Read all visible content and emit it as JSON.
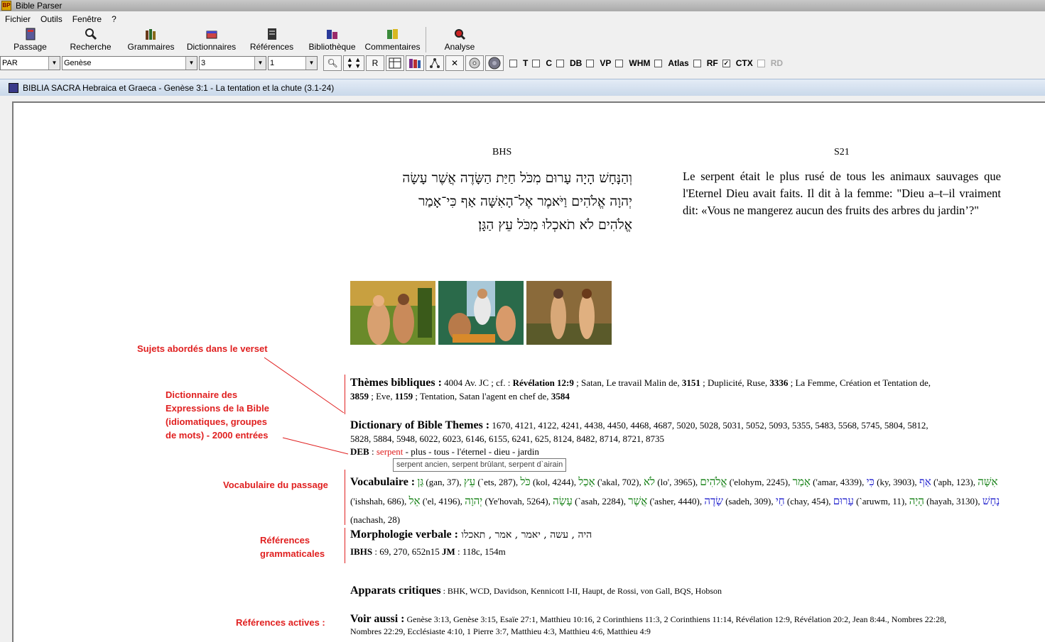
{
  "app": {
    "title": "Bible Parser",
    "icon_text": "BP"
  },
  "menu": [
    "Fichier",
    "Outils",
    "Fenêtre",
    "?"
  ],
  "toolbar": [
    {
      "label": "Passage",
      "icon": "book-icon"
    },
    {
      "label": "Recherche",
      "icon": "search-icon"
    },
    {
      "label": "Grammaires",
      "icon": "books-icon"
    },
    {
      "label": "Dictionnaires",
      "icon": "dictionary-icon"
    },
    {
      "label": "Références",
      "icon": "references-icon"
    },
    {
      "label": "Bibliothèque",
      "icon": "library-icon"
    },
    {
      "label": "Commentaires",
      "icon": "commentary-icon"
    },
    {
      "label": "Analyse",
      "icon": "analyse-icon"
    }
  ],
  "filters": {
    "version": "PAR",
    "book": "Genèse",
    "chapter": "3",
    "verse": "1",
    "r_button": "R"
  },
  "checkboxes": [
    {
      "label": "T",
      "checked": false,
      "enabled": true
    },
    {
      "label": "C",
      "checked": false,
      "enabled": true
    },
    {
      "label": "DB",
      "checked": false,
      "enabled": true
    },
    {
      "label": "VP",
      "checked": false,
      "enabled": true
    },
    {
      "label": "WHM",
      "checked": false,
      "enabled": true
    },
    {
      "label": "Atlas",
      "checked": false,
      "enabled": true
    },
    {
      "label": "RF",
      "checked": false,
      "enabled": true
    },
    {
      "label": "CTX",
      "checked": true,
      "enabled": true
    },
    {
      "label": "RD",
      "checked": false,
      "enabled": false
    }
  ],
  "document": {
    "title": "BIBLIA SACRA Hebraica et Graeca - Genèse 3:1 - La tentation et la chute (3.1-24)",
    "col_left": "BHS",
    "col_right": "S21",
    "hebrew": [
      "וְהַנָּחָשׁ הָיָה עָרוּם מִכֹּל חַיַּת הַשָּׂדֶה אֲשֶׁר עָשָׂה",
      "יְהוָה אֱלֹהִים וַיֹּאמֶר אֶל־הָאִשָּׁה אַף כִּי־אָמַר",
      "אֱלֹהִים לֹא תֹאכְלוּ מִכֹּל עֵץ הַגָּן׃"
    ],
    "french": "Le serpent était le plus rusé de tous les animaux sauvages que l'Eternel Dieu avait faits. Il dit à la femme: \"Dieu a–t–il vraiment dit: «Vous ne mangerez aucun des fruits des arbres du jardin’?\""
  },
  "annotations": {
    "sujets": "Sujets abordés dans le verset",
    "dictionnaire": [
      "Dictionnaire des",
      "Expressions de la Bible",
      "(idiomatiques, groupes",
      "de mots) - 2000 entrées"
    ],
    "vocabulaire": "Vocabulaire du passage",
    "references_gram": [
      "Références",
      "grammaticales"
    ],
    "references_actives": "Références actives :"
  },
  "themes": {
    "label": "Thèmes bibliques :",
    "line1": "4004 Av. JC ; cf. : ",
    "rev": "Révélation 12:9",
    "line1b": " ; Satan, Le travail Malin de, ",
    "n1": "3151",
    "line1c": " ; Duplicité, Ruse, ",
    "n2": "3336",
    "line1d": " ; La Femme, Création et Tentation de,",
    "n3": "3859",
    "line2a": " ; Eve, ",
    "n4": "1159",
    "line2b": " ; Tentation, Satan l'agent en chef de, ",
    "n5": "3584"
  },
  "dbt": {
    "label": "Dictionary of Bible Themes :",
    "line1": " 1670, 4121, 4122, 4241, 4438, 4450, 4468, 4687, 5020, 5028, 5031, 5052, 5093, 5355, 5483, 5568, 5745, 5804, 5812,",
    "line2": "5828, 5884, 5948, 6022, 6023, 6146, 6155, 6241, 625, 8124, 8482, 8714, 8721, 8735"
  },
  "deb": {
    "label": "DEB",
    "colon": " : ",
    "link": "serpent",
    "rest": " - plus - tous - l'éternel - dieu - jardin",
    "tooltip": "serpent ancien, serpent brûlant, serpent d`airain"
  },
  "vocab": {
    "label": "Vocabulaire :",
    "items": [
      {
        "heb": "גַּן",
        "color": "gr",
        "tr": " (gan, 37), "
      },
      {
        "heb": "עֵץ",
        "color": "gr",
        "tr": " (`ets, 287), "
      },
      {
        "heb": "כֹּל",
        "color": "gr",
        "tr": " (kol, 4244), "
      },
      {
        "heb": "אָכַל",
        "color": "gr",
        "tr": " ('akal, 702), "
      },
      {
        "heb": "לֹא",
        "color": "gr",
        "tr": " (lo', 3965), "
      },
      {
        "heb": "אֱלֹהִים",
        "color": "gr",
        "tr": " ('elohym, 2245), "
      },
      {
        "heb": "אָמַר",
        "color": "gr",
        "tr": " ('amar, 4339), "
      },
      {
        "heb": "כִּי",
        "color": "bl",
        "tr": " (ky, 3903), "
      },
      {
        "heb": "אַף",
        "color": "bl",
        "tr": " ('aph, 123), "
      },
      {
        "heb": "אִשָּׁה",
        "color": "gr",
        "tr": " ('ishshah, 686), "
      },
      {
        "heb": "אֵל",
        "color": "gr",
        "tr": " ('el, 4196), "
      },
      {
        "heb": "יְהוָה",
        "color": "gr",
        "tr": " (Ye'hovah, 5264), "
      },
      {
        "heb": "עָשָׂה",
        "color": "gr",
        "tr": " (`asah, 2284), "
      },
      {
        "heb": "אֲשֶׁר",
        "color": "gr",
        "tr": " ('asher, 4440), "
      },
      {
        "heb": "שָׂדֶה",
        "color": "bl",
        "tr": " (sadeh, 309), "
      },
      {
        "heb": "חַי",
        "color": "bl",
        "tr": " (chay, 454), "
      },
      {
        "heb": "עָרוּם",
        "color": "bl",
        "tr": " (`aruwm, 11), "
      },
      {
        "heb": "הָיָה",
        "color": "gr",
        "tr": " (hayah, 3130), "
      },
      {
        "heb": "נָחָשׁ",
        "color": "bl",
        "tr": " (nachash, 28)"
      }
    ]
  },
  "morph": {
    "label": "Morphologie verbale :",
    "words": " היה , עשה , יאמר , אמר , תאכלו",
    "ibhs_label": "IBHS",
    "ibhs": " : 69, 270, 652n15 ",
    "jm_label": "JM",
    "jm": " : 118c, 154m"
  },
  "apparats": {
    "label": "Apparats critiques",
    "text": " : BHK, WCD, Davidson, Kennicott I-II, Haupt, de Rossi, von Gall, BQS, Hobson"
  },
  "voir": {
    "label": "Voir aussi :",
    "line1": " Genèse 3:13, Genèse 3:15, Esaïe 27:1, Matthieu 10:16, 2 Corinthiens 11:3, 2 Corinthiens 11:14, Révélation 12:9, Révélation 20:2, Jean 8:44., Nombres 22:28,",
    "line2": "Nombres 22:29, Ecclésiaste 4:10, 1 Pierre 3:7, Matthieu 4:3, Matthieu 4:6, Matthieu 4:9"
  }
}
